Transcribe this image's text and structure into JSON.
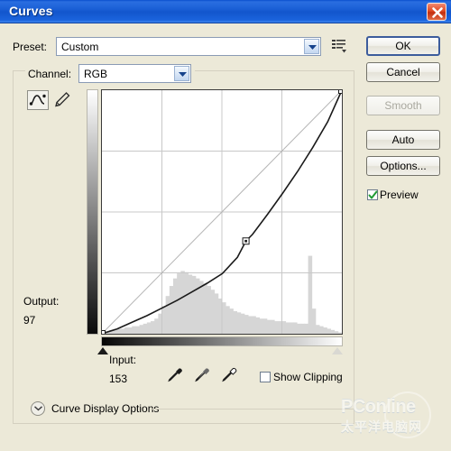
{
  "window": {
    "title": "Curves",
    "close_icon": "close-icon"
  },
  "preset": {
    "label": "Preset:",
    "value": "Custom",
    "placeholder": "Custom",
    "dropdown_icon": "chevron-down-icon",
    "menu_icon": "preset-menu-icon"
  },
  "channel": {
    "label": "Channel:",
    "value": "RGB",
    "dropdown_icon": "chevron-down-icon"
  },
  "tools": {
    "curve_icon": "curve-tool-icon",
    "pencil_icon": "pencil-tool-icon",
    "selected": "curve-tool-icon"
  },
  "buttons": {
    "ok": "OK",
    "cancel": "Cancel",
    "smooth": "Smooth",
    "auto": "Auto",
    "options": "Options..."
  },
  "preview": {
    "label": "Preview",
    "checked": true
  },
  "readout": {
    "output_label": "Output:",
    "output_value": "97",
    "input_label": "Input:",
    "input_value": "153"
  },
  "eyedroppers": [
    {
      "name": "black-point-eyedropper-icon"
    },
    {
      "name": "gray-point-eyedropper-icon"
    },
    {
      "name": "white-point-eyedropper-icon"
    }
  ],
  "clipping": {
    "label": "Show Clipping",
    "checked": false
  },
  "curve_display_options": {
    "label": "Curve Display Options",
    "chevron_icon": "chevron-down-icon",
    "expanded": false
  },
  "sliders": {
    "black_point": "black-slider-handle",
    "white_point": "white-slider-handle"
  },
  "watermark": {
    "english": "PConline",
    "chinese": "太平洋电脑网"
  },
  "colors": {
    "titlebar_blue": "#1255cc",
    "dialog_face": "#ece9d8",
    "curve_line": "#1a1a1a",
    "baseline": "#b5b5b5",
    "grid": "#c8c8c8",
    "histogram": "#d6d6d6",
    "close_red": "#c32f10",
    "check_green": "#1f9b33"
  },
  "chart_data": {
    "type": "line",
    "title": "Curves (RGB)",
    "xlabel": "Input",
    "ylabel": "Output",
    "xlim": [
      0,
      255
    ],
    "ylim": [
      0,
      255
    ],
    "grid": true,
    "grid_divisions": 4,
    "legend": "none",
    "series": [
      {
        "name": "baseline-identity",
        "style": "straight-gray-diagonal",
        "x": [
          0,
          255
        ],
        "y": [
          0,
          255
        ]
      },
      {
        "name": "tone-curve",
        "style": "black-curve",
        "control_points": [
          {
            "input": 0,
            "output": 0
          },
          {
            "input": 153,
            "output": 97
          },
          {
            "input": 255,
            "output": 255
          }
        ],
        "x": [
          0,
          16,
          32,
          48,
          64,
          80,
          96,
          112,
          128,
          144,
          153,
          160,
          176,
          192,
          208,
          224,
          240,
          255
        ],
        "y": [
          0,
          5,
          12,
          19,
          27,
          35,
          44,
          53,
          63,
          80,
          97,
          104,
          125,
          147,
          170,
          195,
          222,
          255
        ]
      }
    ],
    "annotations": [
      {
        "label": "selected control point",
        "input": 153,
        "output": 97
      }
    ],
    "histogram": {
      "name": "image-histogram",
      "bins": 64,
      "values": [
        2,
        2,
        3,
        3,
        4,
        4,
        5,
        5,
        6,
        6,
        7,
        8,
        9,
        10,
        12,
        16,
        22,
        30,
        38,
        44,
        48,
        50,
        49,
        47,
        46,
        44,
        42,
        40,
        38,
        35,
        32,
        28,
        25,
        22,
        20,
        18,
        17,
        16,
        15,
        14,
        14,
        13,
        12,
        12,
        11,
        11,
        10,
        10,
        10,
        9,
        9,
        9,
        8,
        8,
        8,
        62,
        20,
        7,
        6,
        5,
        4,
        3,
        2,
        1
      ]
    }
  }
}
